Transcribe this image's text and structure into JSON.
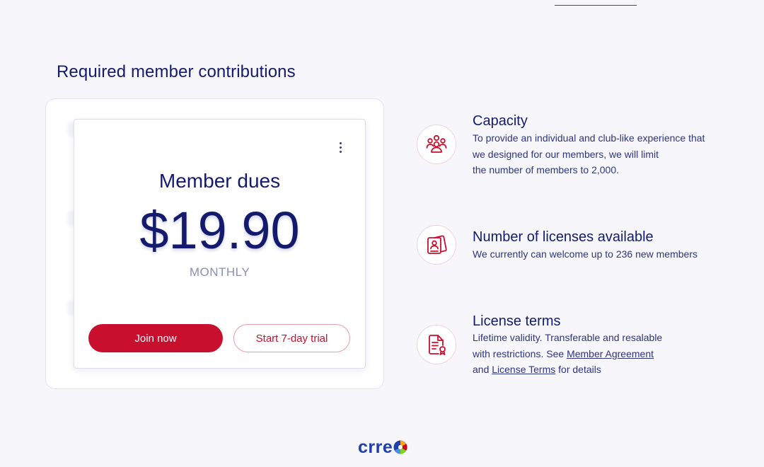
{
  "section": {
    "title": "Required member contributions"
  },
  "plan": {
    "label": "Member dues",
    "price": "$19.90",
    "period": "MONTHLY",
    "primary_button": "Join now",
    "secondary_button": "Start 7-day trial",
    "menu_icon": "more-vertical-icon"
  },
  "features": [
    {
      "icon": "people-group-icon",
      "title": "Capacity",
      "lines": [
        "To provide an individual and club-like experience that",
        "we designed for our members, we will limit",
        "the number of members to 2,000."
      ]
    },
    {
      "icon": "license-card-icon",
      "title": "Number of licenses available",
      "lines": [
        "We currently can welcome up to 236 new members"
      ]
    },
    {
      "icon": "document-certificate-icon",
      "title": "License terms",
      "line1": "Lifetime validity. Transferable and resalable",
      "line2_prefix": "with restrictions. See ",
      "member_agreement_link": "Member Agreement",
      "line3_prefix": "and ",
      "license_terms_link": "License Terms",
      "line3_suffix": " for details"
    }
  ],
  "footer": {
    "logo_text": "crre",
    "logo_icon": "color-wheel-logo-icon"
  },
  "colors": {
    "brand_navy": "#141b6e",
    "accent_red": "#c8102e",
    "background": "#f6f6fb"
  }
}
